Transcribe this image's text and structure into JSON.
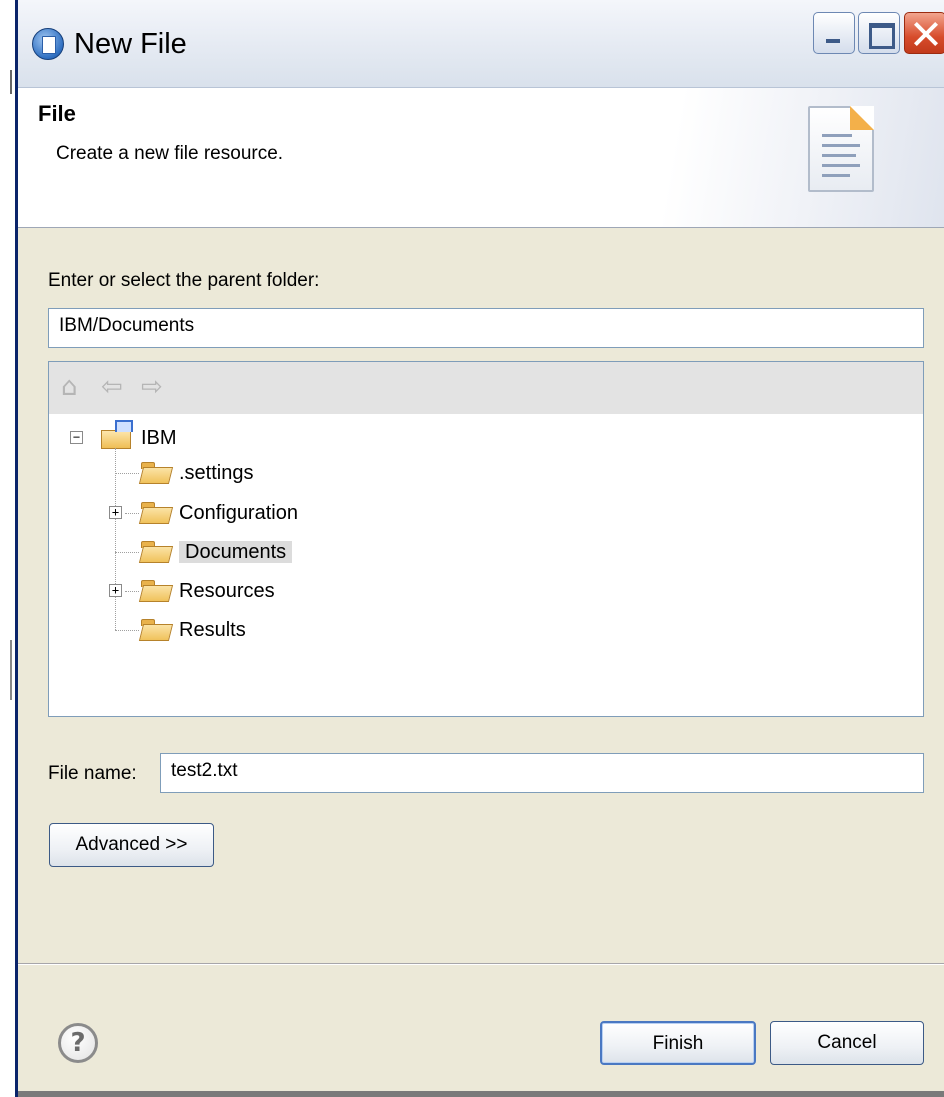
{
  "window": {
    "title": "New File",
    "controls": [
      "minimize-icon",
      "maximize-icon",
      "close-icon"
    ]
  },
  "banner": {
    "title": "File",
    "description": "Create a new file resource.",
    "icon": "document-icon"
  },
  "parent_folder": {
    "label": "Enter or select the parent folder:",
    "value": "IBM/Documents"
  },
  "tree_toolbar": {
    "icons": [
      "home-icon",
      "back-arrow-icon",
      "forward-arrow-icon"
    ]
  },
  "tree": {
    "root": {
      "label": "IBM",
      "expanded": true
    },
    "children": [
      {
        "label": ".settings",
        "expandable": false
      },
      {
        "label": "Configuration",
        "expandable": true
      },
      {
        "label": "Documents",
        "expandable": false,
        "selected": true
      },
      {
        "label": "Resources",
        "expandable": true
      },
      {
        "label": "Results",
        "expandable": false
      }
    ]
  },
  "file_name": {
    "label": "File name:",
    "value": "test2.txt"
  },
  "buttons": {
    "advanced": "Advanced >>",
    "finish": "Finish",
    "cancel": "Cancel"
  },
  "help": {
    "glyph": "?"
  },
  "glyphs": {
    "home": "⌂",
    "back": "⇦",
    "forward": "⇨",
    "minus": "−",
    "plus": "+"
  }
}
